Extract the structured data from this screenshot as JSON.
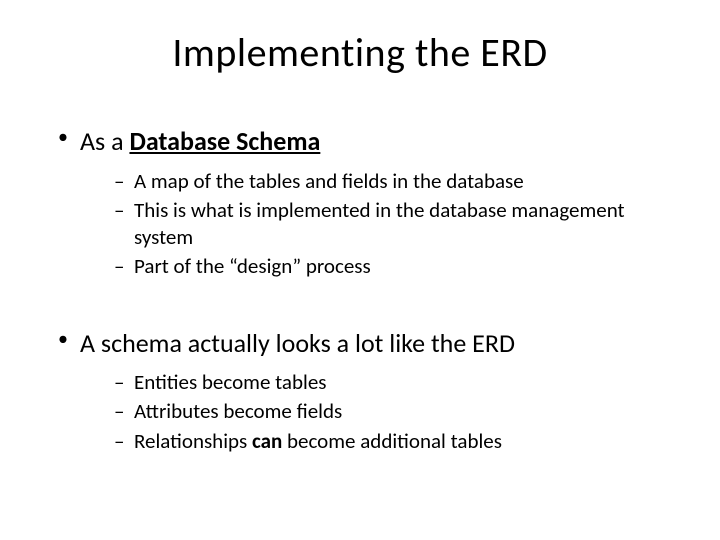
{
  "title": "Implementing the ERD",
  "bullets": [
    {
      "prefix": "As a ",
      "emphasis": "Database Schema",
      "suffix": "",
      "emphasis_style": "underline-bold",
      "subs": [
        "A map of the tables and fields in the database",
        "This is what is implemented in the database management system",
        "Part of the “design” process"
      ]
    },
    {
      "prefix": "A schema actually looks a lot like the ERD",
      "emphasis": "",
      "suffix": "",
      "emphasis_style": "",
      "subs_mixed": [
        {
          "text": "Entities become tables"
        },
        {
          "text": "Attributes become fields"
        },
        {
          "prefix": "Relationships ",
          "bold": "can",
          "suffix": " become additional tables"
        }
      ]
    }
  ]
}
